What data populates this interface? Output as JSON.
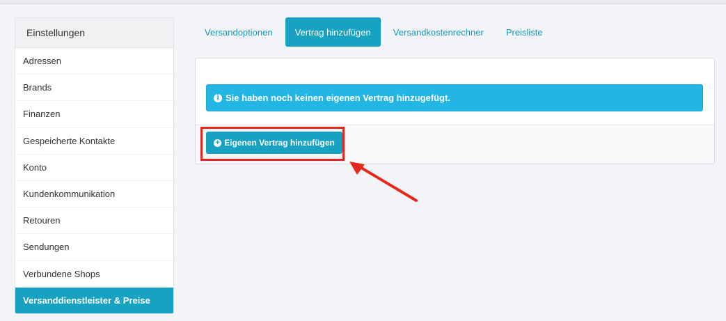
{
  "sidebar": {
    "header": "Einstellungen",
    "items": [
      {
        "label": "Adressen"
      },
      {
        "label": "Brands"
      },
      {
        "label": "Finanzen"
      },
      {
        "label": "Gespeicherte Kontakte"
      },
      {
        "label": "Konto"
      },
      {
        "label": "Kundenkommunikation"
      },
      {
        "label": "Retouren"
      },
      {
        "label": "Sendungen"
      },
      {
        "label": "Verbundene Shops"
      },
      {
        "label": "Versanddienstleister & Preise",
        "active": true
      }
    ]
  },
  "tabs": [
    {
      "label": "Versandoptionen"
    },
    {
      "label": "Vertrag hinzufügen",
      "active": true
    },
    {
      "label": "Versandkostenrechner"
    },
    {
      "label": "Preisliste"
    }
  ],
  "panel": {
    "alert_text": "Sie haben noch keinen eigenen Vertrag hinzugefügt.",
    "alert_icon": "info-icon",
    "add_button_label": "Eigenen Vertrag hinzufügen",
    "add_button_icon": "plus-circle-icon"
  },
  "colors": {
    "accent": "#17a2c2",
    "alert": "#23b5e3",
    "highlight": "#e8271c"
  }
}
